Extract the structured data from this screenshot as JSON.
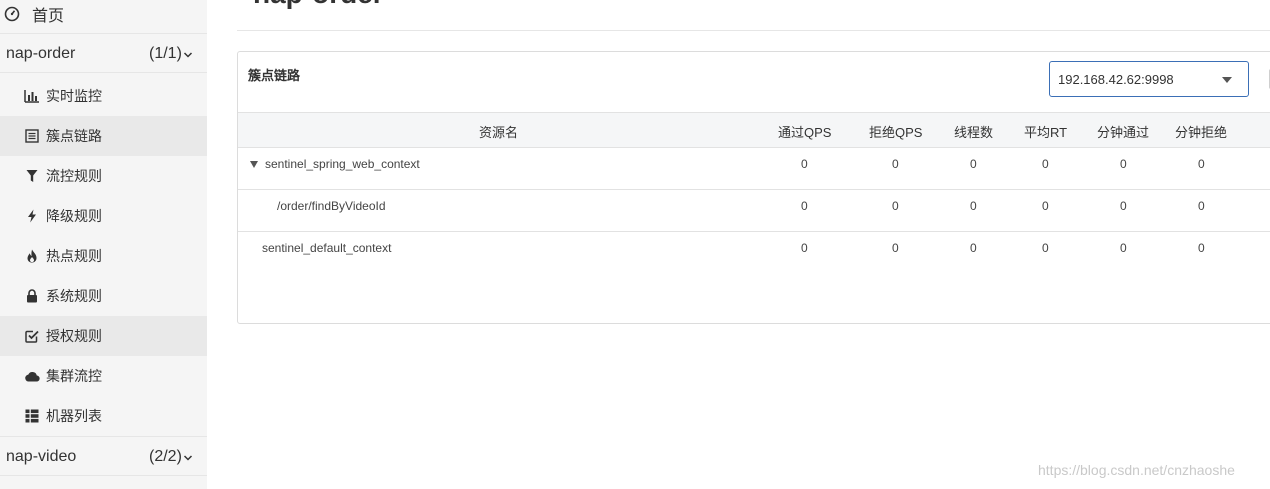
{
  "sidebar": {
    "home_label": "首页",
    "app1": {
      "name": "nap-order",
      "count": "(1/1)"
    },
    "menu": [
      {
        "label": "实时监控",
        "icon": "bar-chart-icon"
      },
      {
        "label": "簇点链路",
        "icon": "list-icon"
      },
      {
        "label": "流控规则",
        "icon": "filter-icon"
      },
      {
        "label": "降级规则",
        "icon": "bolt-icon"
      },
      {
        "label": "热点规则",
        "icon": "fire-icon"
      },
      {
        "label": "系统规则",
        "icon": "lock-icon"
      },
      {
        "label": "授权规则",
        "icon": "check-square-icon"
      },
      {
        "label": "集群流控",
        "icon": "cloud-icon"
      },
      {
        "label": "机器列表",
        "icon": "grid-list-icon"
      }
    ],
    "app2": {
      "name": "nap-video",
      "count": "(2/2)"
    }
  },
  "page": {
    "title": "nap-order"
  },
  "panel": {
    "title": "簇点链路",
    "machine_select": "192.168.42.62:9998"
  },
  "table": {
    "headers": [
      "资源名",
      "通过QPS",
      "拒绝QPS",
      "线程数",
      "平均RT",
      "分钟通过",
      "分钟拒绝"
    ],
    "rows": [
      {
        "resource": "sentinel_spring_web_context",
        "values": [
          "0",
          "0",
          "0",
          "0",
          "0",
          "0"
        ]
      },
      {
        "resource": "/order/findByVideoId",
        "values": [
          "0",
          "0",
          "0",
          "0",
          "0",
          "0"
        ]
      },
      {
        "resource": "sentinel_default_context",
        "values": [
          "0",
          "0",
          "0",
          "0",
          "0",
          "0"
        ]
      }
    ]
  },
  "watermark": "https://blog.csdn.net/cnzhaoshe",
  "colors": {
    "accent": "#3b6fb6",
    "sidebar_bg": "#f5f5f5",
    "active_bg": "#e9e9e9"
  }
}
